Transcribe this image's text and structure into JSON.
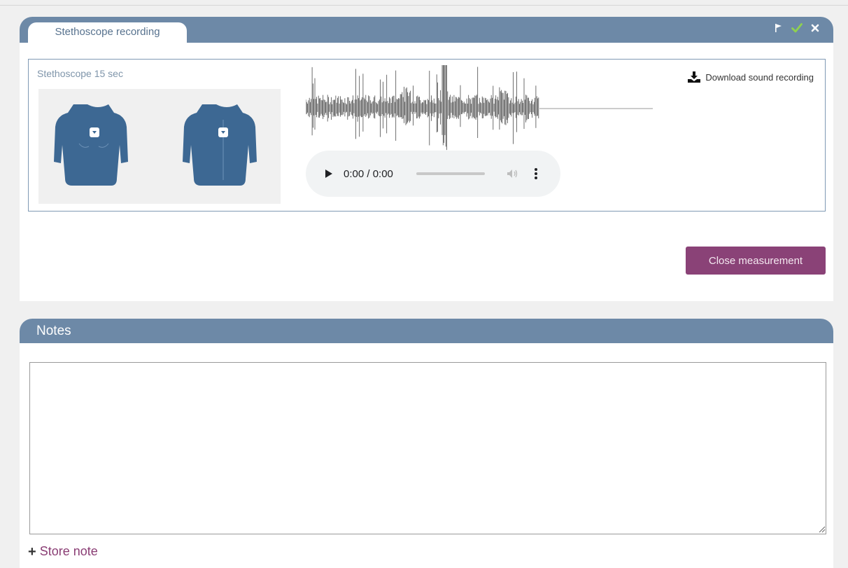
{
  "measurement": {
    "tab_label": "Stethoscope recording",
    "recording_title": "Stethoscope 15 sec",
    "download_label": "Download sound recording",
    "close_button_label": "Close measurement",
    "header_icons": [
      "flag-icon",
      "check-icon",
      "close-icon"
    ]
  },
  "player": {
    "time": "0:00 / 0:00",
    "progress": 0
  },
  "notes": {
    "title": "Notes",
    "textarea_value": "",
    "store_label": "Store note"
  },
  "colors": {
    "header": "#6d89a7",
    "accent_button": "#8a4277",
    "link": "#8a3d74",
    "check": "#8fd14f",
    "body_figure": "#3d6893"
  }
}
